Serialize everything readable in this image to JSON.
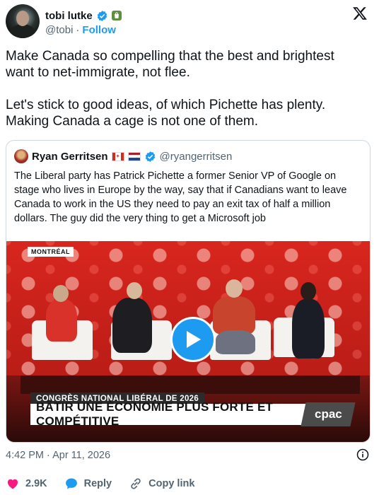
{
  "author": {
    "name": "tobi lutke",
    "handle": "@tobi",
    "separator": "·",
    "follow_label": "Follow",
    "avatar_icon": "profile-photo"
  },
  "tweet": {
    "paragraphs": [
      "Make Canada so compelling that the best and brightest want to net-immigrate, not flee.",
      "Let's stick to good ideas, of which Pichette has plenty. Making Canada a cage is not one of them."
    ]
  },
  "quoted": {
    "name": "Ryan Gerritsen",
    "handle": "@ryangerritsen",
    "text": "The Liberal party has Patrick Pichette a former Senior VP of Google on stage who lives in Europe by the way, say that if Canadians want to leave Canada to work in the US they need to pay an exit tax of half a million dollars. The guy did the very thing to get a Microsoft job",
    "video": {
      "location_tag": "MONTRÉAL",
      "banner_top": "CONGRÈS NATIONAL LIBÉRAL DE 2026",
      "banner_main": "BÂTIR UNE ÉCONOMIE PLUS FORTE ET COMPÉTITIVE",
      "network_logo": "cpac"
    }
  },
  "meta": {
    "timestamp": "4:42 PM · Apr 11, 2026"
  },
  "actions": {
    "like_count": "2.9K",
    "reply_label": "Reply",
    "copy_label": "Copy link"
  },
  "colors": {
    "accent": "#1d9bf0",
    "like": "#f91880",
    "text": "#0f1419",
    "muted": "#536471"
  }
}
